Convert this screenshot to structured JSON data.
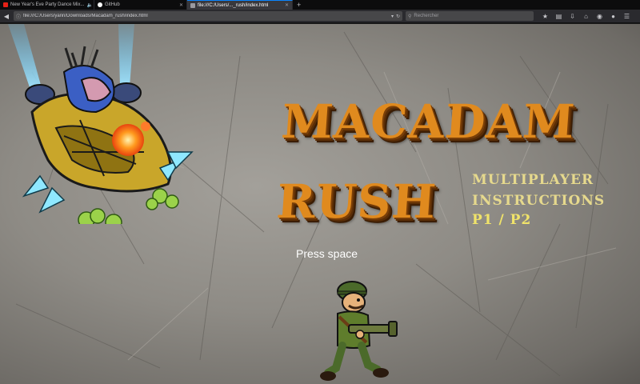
{
  "browser": {
    "tabs": [
      {
        "title": "New Year's Eve Party Dance Mix...",
        "active": false,
        "audio": true,
        "favicon_color": "#e62117"
      },
      {
        "title": "GitHub",
        "active": false,
        "audio": false,
        "favicon_color": "#ffffff"
      },
      {
        "title": "file:///C:/Users/..._rush/index.html",
        "active": true,
        "audio": false,
        "favicon_color": "#9a9aa0"
      }
    ],
    "new_tab_symbol": "+",
    "url": "file:///C:/Users/yann/Downloads/Macadam_rush/index.html",
    "search_placeholder": "Rechercher",
    "icons": [
      "back-icon",
      "info-icon",
      "dropdown-icon",
      "reload-icon",
      "search-icon",
      "bookmark-star-icon",
      "library-icon",
      "download-icon",
      "home-icon",
      "pocket-icon",
      "extension-icon",
      "menu-icon"
    ],
    "accent": "#0a84ff"
  },
  "game": {
    "title_line1": "MACADAM",
    "title_line2": "RUSH",
    "press_prompt": "Press space",
    "menu": {
      "multiplayer": "MULTIPLAYER",
      "instructions": "INSTRUCTIONS",
      "players": "P1 / P2"
    },
    "sprites": [
      "boss-ship-sprite",
      "soldier-player-sprite"
    ],
    "colors": {
      "title": "#e08a1e",
      "menu": "#e6d98d",
      "players": "#f0e36a",
      "background": "#8e8b85"
    }
  }
}
